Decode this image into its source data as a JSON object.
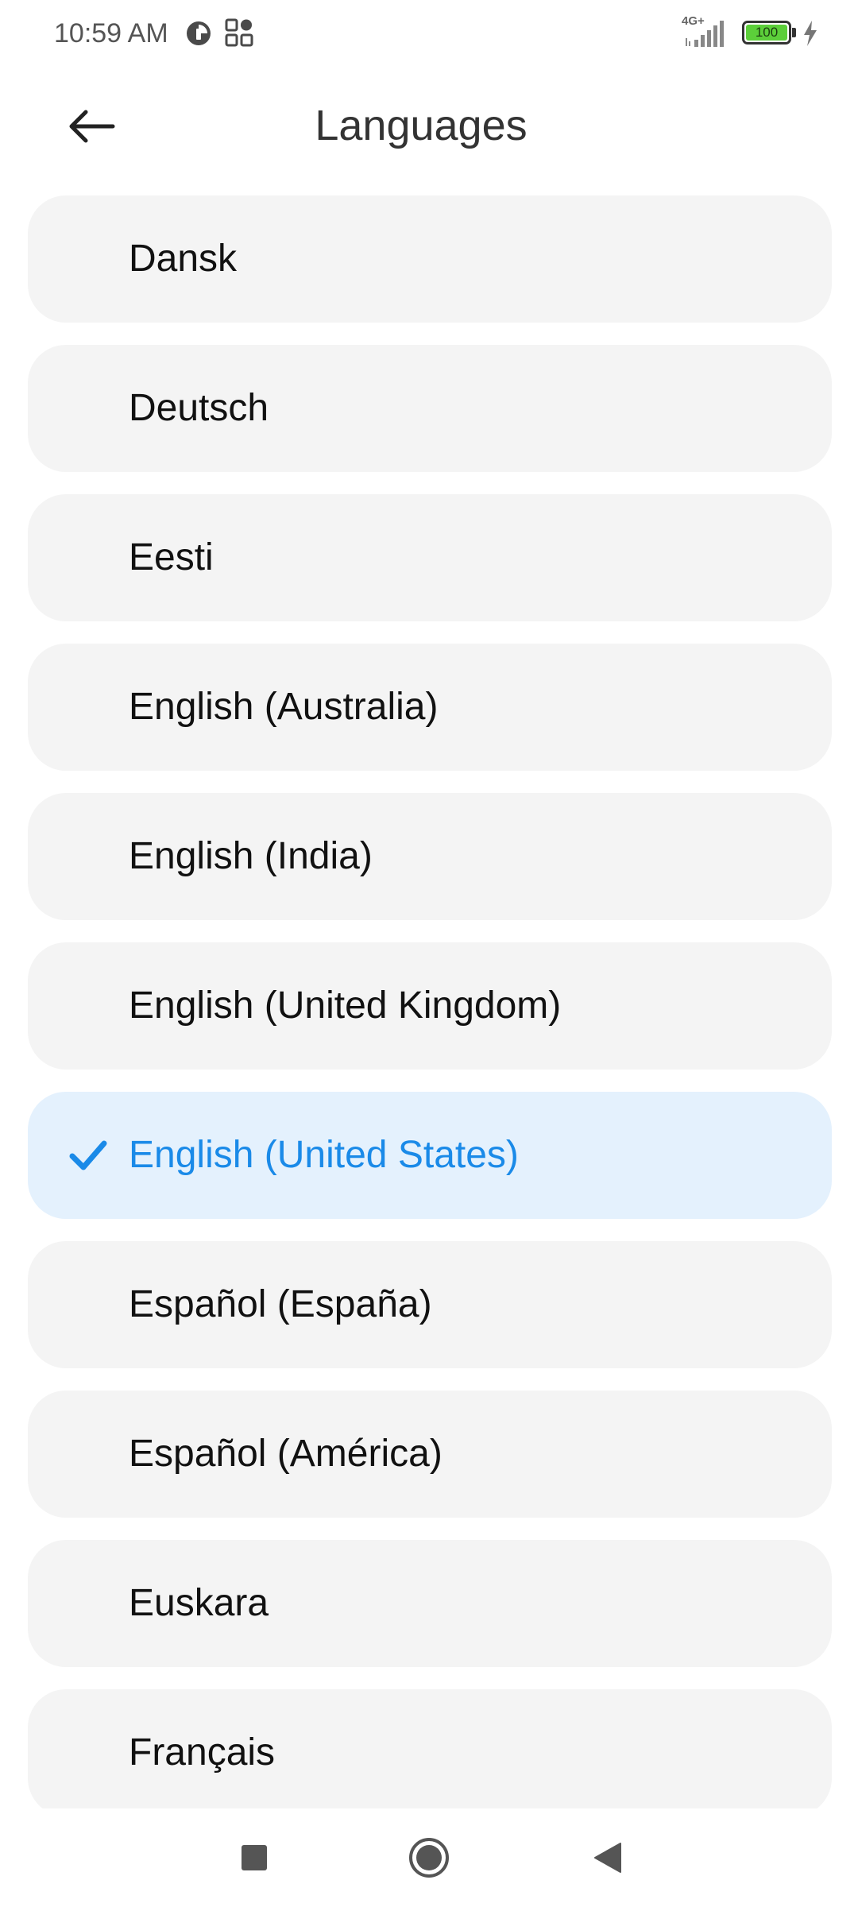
{
  "status_bar": {
    "time": "10:59 AM",
    "network": "4G+",
    "battery": "100",
    "icons": [
      "data-saver-icon",
      "grid-app-icon",
      "signal-icon",
      "battery-icon",
      "charging-bolt-icon"
    ]
  },
  "header": {
    "title": "Languages",
    "back_icon": "back-arrow-icon"
  },
  "languages": [
    {
      "label": "Dansk",
      "selected": false
    },
    {
      "label": "Deutsch",
      "selected": false
    },
    {
      "label": "Eesti",
      "selected": false
    },
    {
      "label": "English (Australia)",
      "selected": false
    },
    {
      "label": "English (India)",
      "selected": false
    },
    {
      "label": "English (United Kingdom)",
      "selected": false
    },
    {
      "label": "English (United States)",
      "selected": true
    },
    {
      "label": "Español (España)",
      "selected": false
    },
    {
      "label": "Español (América)",
      "selected": false
    },
    {
      "label": "Euskara",
      "selected": false
    },
    {
      "label": "Français",
      "selected": false
    }
  ],
  "nav_bar": {
    "icons": [
      "recents-square-icon",
      "home-circle-icon",
      "back-triangle-icon"
    ]
  },
  "colors": {
    "accent": "#1a8ae8",
    "selected_bg": "#e4f1fd",
    "item_bg": "#f4f4f4",
    "battery_fill": "#5ccf3a"
  }
}
